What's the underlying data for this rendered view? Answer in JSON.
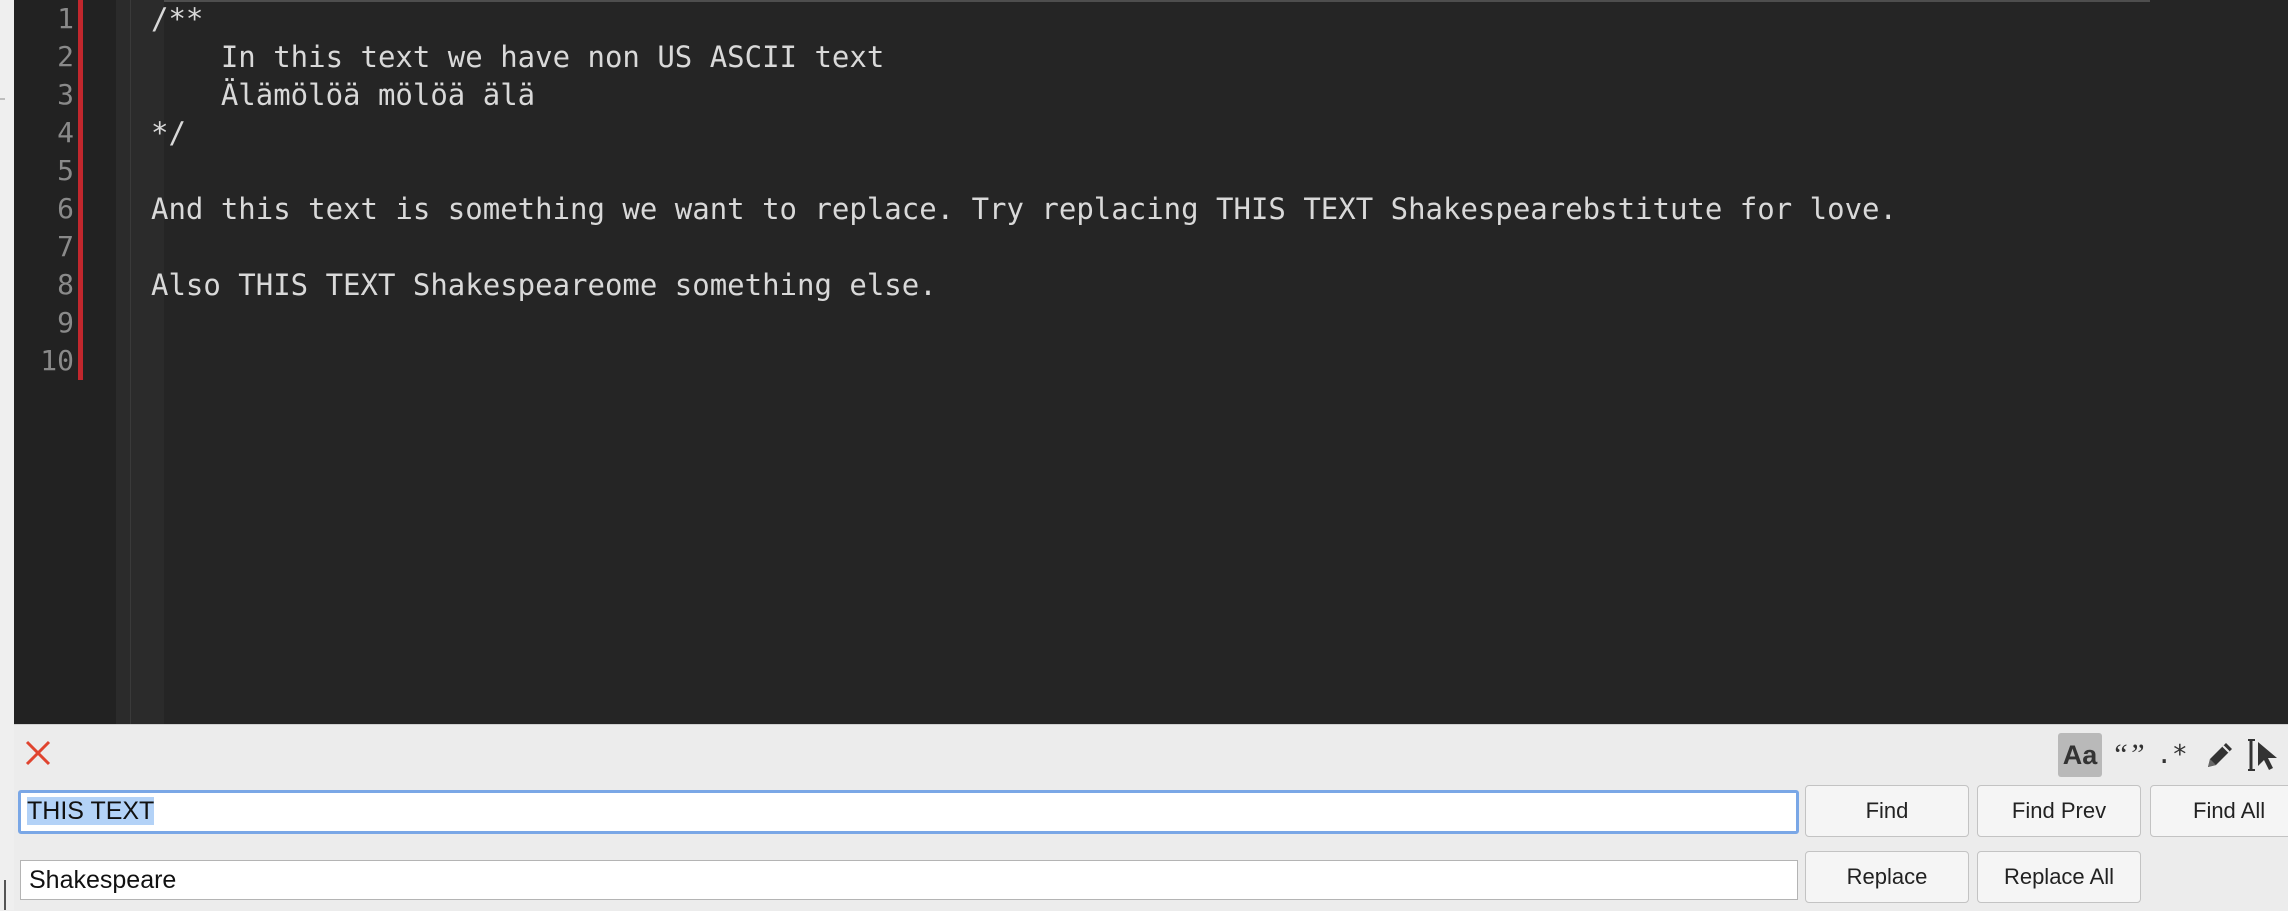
{
  "editor": {
    "line_numbers": [
      "1",
      "2",
      "3",
      "4",
      "5",
      "6",
      "7",
      "8",
      "9",
      "10"
    ],
    "lines": [
      "/**",
      "    In this text we have non US ASCII text",
      "    Älämölöä mölöä älä",
      "*/",
      "",
      "And this text is something we want to replace. Try replacing THIS TEXT Shakespearebstitute for love.",
      "",
      "Also THIS TEXT Shakespeareome something else.",
      "",
      ""
    ]
  },
  "findbar": {
    "find_value": "THIS TEXT",
    "replace_value": "Shakespeare",
    "options": {
      "match_case": "Aa",
      "whole_word": "“”",
      "regex": ".*"
    },
    "buttons": {
      "find": "Find",
      "find_prev": "Find Prev",
      "find_all": "Find All",
      "replace": "Replace",
      "replace_all": "Replace All"
    },
    "icons": {
      "close": "close-icon",
      "pencil": "pencil-icon",
      "select_cursor": "select-cursor-icon"
    },
    "colors": {
      "close": "#e0442f",
      "focus_ring": "#7aa7e6",
      "selection": "#b3d2f7",
      "change_bar": "#c1272d"
    }
  }
}
